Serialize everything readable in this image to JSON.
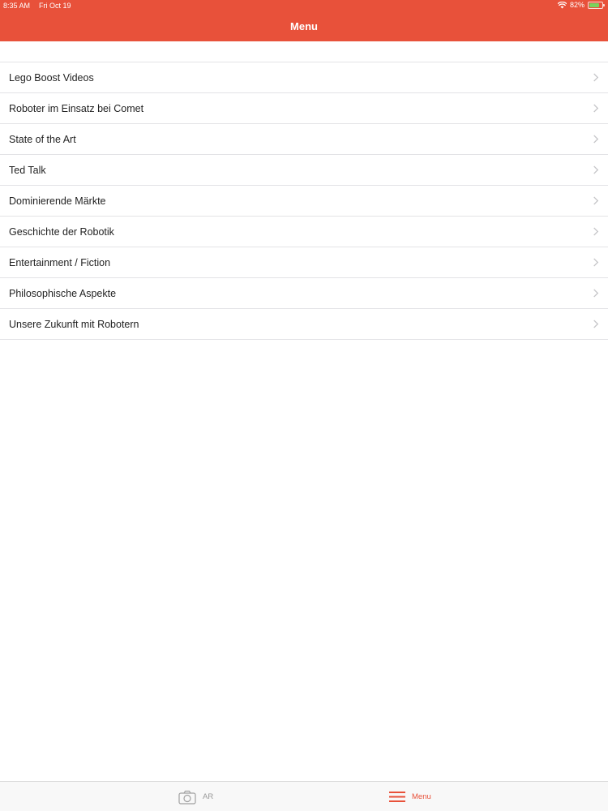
{
  "status_bar": {
    "time": "8:35 AM",
    "date": "Fri Oct 19",
    "battery_percent": "82%",
    "battery_level": 0.82
  },
  "nav": {
    "title": "Menu"
  },
  "menu_items": [
    {
      "label": "Lego Boost Videos"
    },
    {
      "label": "Roboter im Einsatz bei Comet"
    },
    {
      "label": "State of the Art"
    },
    {
      "label": "Ted Talk"
    },
    {
      "label": "Dominierende Märkte"
    },
    {
      "label": "Geschichte der Robotik"
    },
    {
      "label": "Entertainment / Fiction"
    },
    {
      "label": "Philosophische Aspekte"
    },
    {
      "label": "Unsere Zukunft mit Robotern"
    }
  ],
  "tabbar": {
    "ar": {
      "label": "AR",
      "icon": "camera-icon"
    },
    "menu": {
      "label": "Menu",
      "icon": "hamburger-icon",
      "active": true
    }
  },
  "colors": {
    "accent": "#e8513a",
    "separator": "#e3e3e6",
    "inactive_tab": "#999999",
    "battery": "#7ad35d"
  }
}
